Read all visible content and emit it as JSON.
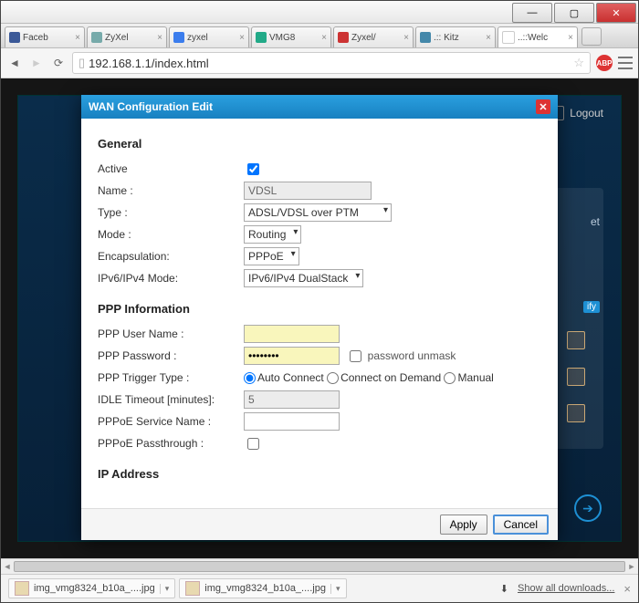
{
  "window": {
    "min": "—",
    "max": "▢",
    "close": "✕"
  },
  "tabs": [
    {
      "label": "Faceb",
      "color": "#3b5998"
    },
    {
      "label": "ZyXel",
      "color": "#7aa"
    },
    {
      "label": "zyxel",
      "color": "#3b7ded"
    },
    {
      "label": "VMG8",
      "color": "#2a8"
    },
    {
      "label": "Zyxel/",
      "color": "#c33"
    },
    {
      "label": ".:: Kitz",
      "color": "#48a"
    },
    {
      "label": "..::Welc",
      "color": "#fff",
      "active": true
    }
  ],
  "address": {
    "url": "192.168.1.1/index.html",
    "adblock": "ABP"
  },
  "logout": "Logout",
  "bgpanel": {
    "hdr": "ify",
    "et": "et"
  },
  "modal": {
    "title": "WAN Configuration Edit",
    "sections": {
      "general": "General",
      "ppp": "PPP Information",
      "ip": "IP Address"
    },
    "labels": {
      "active": "Active",
      "name": "Name :",
      "type": "Type :",
      "mode": "Mode :",
      "encap": "Encapsulation:",
      "ipmode": "IPv6/IPv4 Mode:",
      "pppuser": "PPP User Name :",
      "ppppass": "PPP Password :",
      "unmask": "password unmask",
      "trigger": "PPP Trigger Type :",
      "idle": "IDLE Timeout [minutes]:",
      "svcname": "PPPoE Service Name :",
      "passthru": "PPPoE Passthrough :"
    },
    "values": {
      "name": "VDSL",
      "type": "ADSL/VDSL over PTM",
      "mode": "Routing",
      "encap": "PPPoE",
      "ipmode": "IPv6/IPv4 DualStack",
      "pppuser": "",
      "ppppass": "••••••••",
      "idle": "5",
      "svcname": ""
    },
    "trigger_opts": {
      "auto": "Auto Connect",
      "demand": "Connect on Demand",
      "manual": "Manual"
    },
    "buttons": {
      "apply": "Apply",
      "cancel": "Cancel"
    }
  },
  "downloads": {
    "item": "img_vmg8324_b10a_....jpg",
    "showall": "Show all downloads...",
    "arrow": "⬇"
  }
}
